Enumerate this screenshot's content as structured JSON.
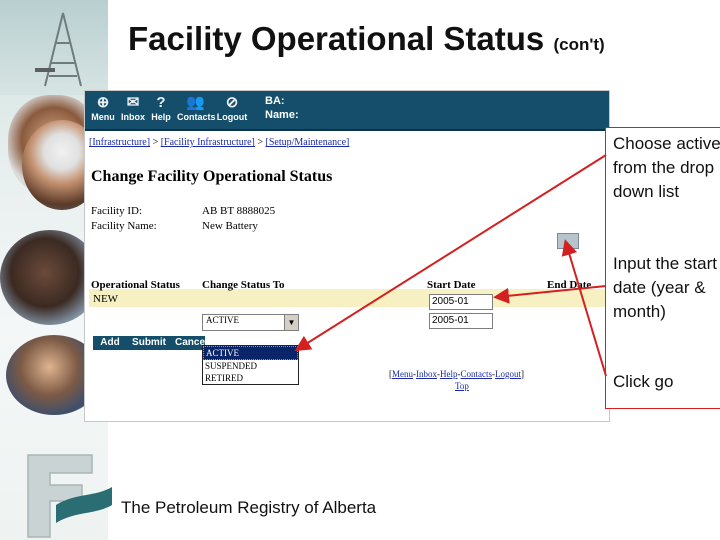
{
  "slide": {
    "title": "Facility Operational Status",
    "title_suffix": "(con't)",
    "footer": "The Petroleum Registry of Alberta"
  },
  "toolbar": {
    "items": [
      {
        "label": "Menu",
        "icon": "menu-icon",
        "glyph": "⊕"
      },
      {
        "label": "Inbox",
        "icon": "envelope-icon",
        "glyph": "✉"
      },
      {
        "label": "Help",
        "icon": "help-icon",
        "glyph": "?"
      },
      {
        "label": "Contacts",
        "icon": "contacts-icon",
        "glyph": "👥"
      },
      {
        "label": "Logout",
        "icon": "logout-icon",
        "glyph": "⊘"
      }
    ],
    "ba_label": "BA:",
    "name_label": "Name:"
  },
  "breadcrumb": {
    "items": [
      "[Infrastructure]",
      "[Facility Infrastructure]",
      "[Setup/Maintenance]"
    ],
    "separator": ">"
  },
  "form": {
    "heading": "Change Facility Operational Status",
    "facility_id_label": "Facility ID:",
    "facility_id_value": "AB BT 8888025",
    "facility_name_label": "Facility Name:",
    "facility_name_value": "New Battery",
    "columns": {
      "operational_status": "Operational Status",
      "change_status_to": "Change Status To",
      "start_date": "Start Date",
      "end_date": "End Date"
    },
    "current_status": "NEW",
    "start_date_1": "2005-01",
    "start_date_2": "2005-01",
    "selected_status": "ACTIVE",
    "buttons": {
      "add": "Add",
      "submit": "Submit",
      "cancel": "Cancel"
    },
    "dropdown_options": [
      "ACTIVE",
      "SUSPENDED",
      "RETIRED"
    ],
    "footer_links": [
      "Menu",
      "Inbox",
      "Help",
      "Contacts",
      "Logout"
    ],
    "top_link": "Top"
  },
  "annotations": {
    "note1": "Choose active from the drop down list",
    "note2": "Input the start date (year & month)",
    "note3": "Click go",
    "color": "#d32020"
  },
  "colors": {
    "toolbar_bg": "#154e6a",
    "highlight_row": "#f6f0c2",
    "link": "#1a2aa8"
  }
}
